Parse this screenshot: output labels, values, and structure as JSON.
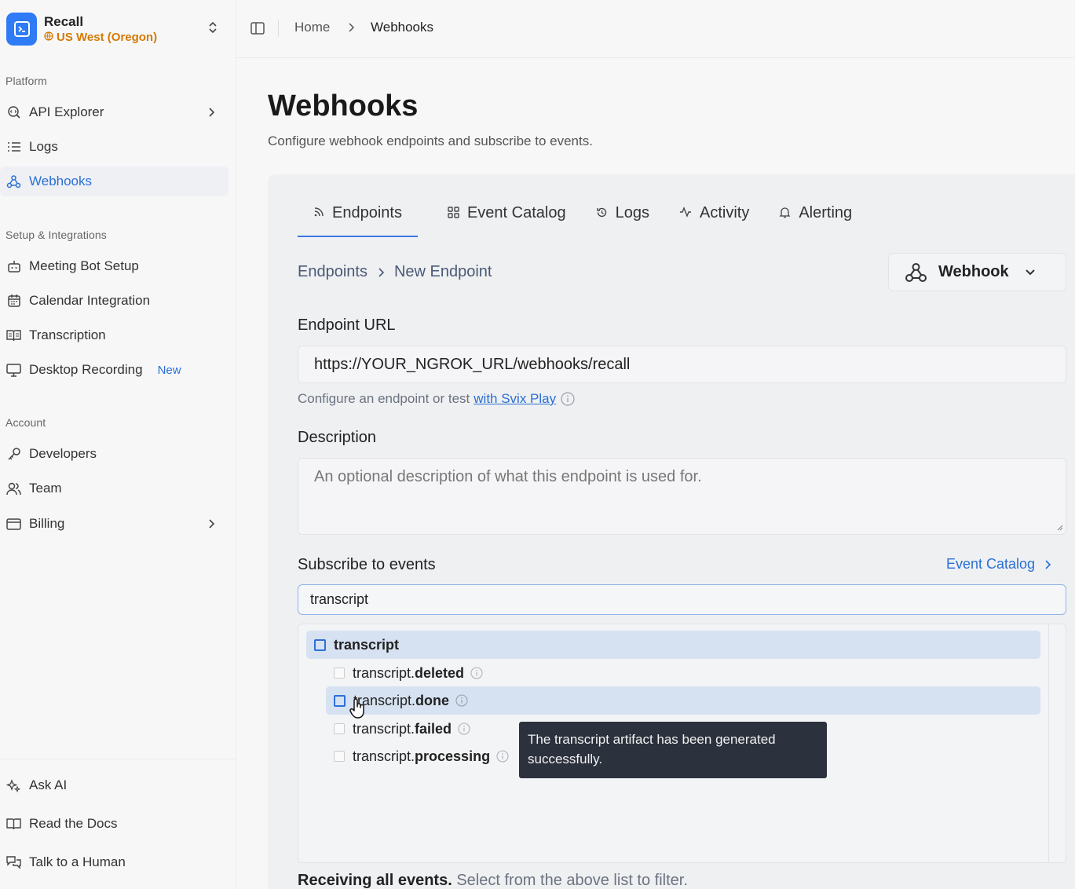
{
  "org": {
    "name": "Recall",
    "region": "US West (Oregon)"
  },
  "sidebar": {
    "platform_label": "Platform",
    "setup_label": "Setup & Integrations",
    "account_label": "Account",
    "items": {
      "api_explorer": "API Explorer",
      "logs": "Logs",
      "webhooks": "Webhooks",
      "meeting_bot": "Meeting Bot Setup",
      "calendar": "Calendar Integration",
      "transcription": "Transcription",
      "desktop": "Desktop Recording",
      "desktop_badge": "New",
      "developers": "Developers",
      "team": "Team",
      "billing": "Billing",
      "ask_ai": "Ask AI",
      "docs": "Read the Docs",
      "human": "Talk to a Human"
    }
  },
  "breadcrumb": {
    "home": "Home",
    "current": "Webhooks"
  },
  "page": {
    "title": "Webhooks",
    "subtitle": "Configure webhook endpoints and subscribe to events."
  },
  "tabs": {
    "endpoints": "Endpoints",
    "event_catalog": "Event Catalog",
    "logs": "Logs",
    "activity": "Activity",
    "alerting": "Alerting"
  },
  "endpoint_crumb": {
    "parent": "Endpoints",
    "current": "New Endpoint"
  },
  "webhook_button": "Webhook",
  "form": {
    "url_label": "Endpoint URL",
    "url_value": "https://YOUR_NGROK_URL/webhooks/recall",
    "hint_prefix": "Configure an endpoint or test",
    "hint_link": "with Svix Play",
    "description_label": "Description",
    "description_placeholder": "An optional description of what this endpoint is used for.",
    "subscribe_label": "Subscribe to events",
    "event_catalog_link": "Event Catalog",
    "search_value": "transcript"
  },
  "events": {
    "group": "transcript",
    "items": [
      {
        "prefix": "transcript.",
        "suffix": "deleted"
      },
      {
        "prefix": "transcript.",
        "suffix": "done"
      },
      {
        "prefix": "transcript.",
        "suffix": "failed"
      },
      {
        "prefix": "transcript.",
        "suffix": "processing"
      }
    ]
  },
  "tooltip": "The transcript artifact has been generated successfully.",
  "footer": {
    "bold": "Receiving all events.",
    "muted": "Select from the above list to filter."
  },
  "colors": {
    "accent": "#2f7af5",
    "link": "#2a6fd6",
    "region": "#d47a00",
    "tooltip_bg": "#2b313d"
  }
}
